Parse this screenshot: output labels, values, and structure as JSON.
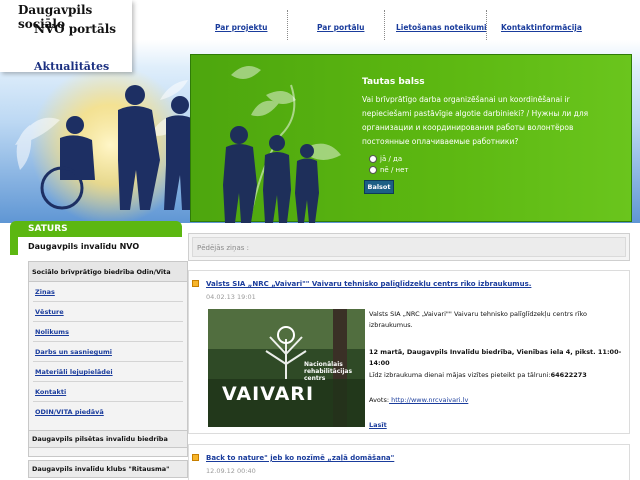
{
  "header": {
    "logo_line1": "Daugavpils sociālo",
    "logo_line2": "NVO portāls",
    "current_section": "Aktualitātes",
    "nav": [
      "Par projektu",
      "Par portālu",
      "Lietošanas noteikumi",
      "Kontaktinformācija"
    ]
  },
  "poll": {
    "title": "Tautas balss",
    "question": "Vai brīvprātīgo darba organizēšanai un koordinēšanai ir nepieciešami pastāvīgie algotie darbinieki? / Нужны ли для организации и координирования работы волонтёров постоянные оплачиваемые работники?",
    "options": [
      "jā / да",
      "nē / нет"
    ],
    "vote_button": "Balsot"
  },
  "sidebar": {
    "header": "SATURS",
    "title": "Daugavpils invalīdu NVO",
    "box_title": "Sociālo brīvprātīgo biedrība Odin/Vita",
    "links": [
      "Ziņas",
      "Vēsture",
      "Nolikums",
      "Darbs un sasniegumi",
      "Materiāli lejupielādei",
      "Kontakti",
      "ODIN/VITA piedāvā"
    ],
    "other_orgs": [
      "Daugavpils pilsētas invalīdu biedrība",
      "Daugavpils invalīdu klubs \"Ritausma\""
    ]
  },
  "latest": {
    "label": "Pēdējās ziņas :"
  },
  "news": [
    {
      "title": "Valsts SIA „NRC „Vaivari\"\" Vaivaru tehnisko palīglīdzekļu centrs rīko izbraukumus.",
      "date": "04.02.13 19:01",
      "para1": "Valsts SIA „NRC „Vaivari\"\" Vaivaru tehnisko palīglīdzekļu centrs rīko izbraukumus.",
      "para2_bold": "12 martā, Daugavpils Invalīdu biedrība, Vienības iela 4, pikst. 11:00-14:00",
      "para3_text": "Līdz izbraukuma dienai mājas vizītes pieteikt pa tālruni:",
      "para3_phone": "64622273",
      "web_label": "Avots:",
      "web_link": " http://www.nrcvaivari.lv",
      "read_more": "Lasīt",
      "image_text1": "Nacionālais",
      "image_text2": "rehabilitācijas",
      "image_text3": "centrs",
      "image_brand": "VAIVARI"
    },
    {
      "title": "Back to nature\" jeb ko nozīmē „zaļā domāšana\"",
      "date": "12.09.12 00:40"
    }
  ],
  "colors": {
    "green": "#5cb711",
    "link": "#1a3c9c",
    "button": "#1c5f85"
  }
}
